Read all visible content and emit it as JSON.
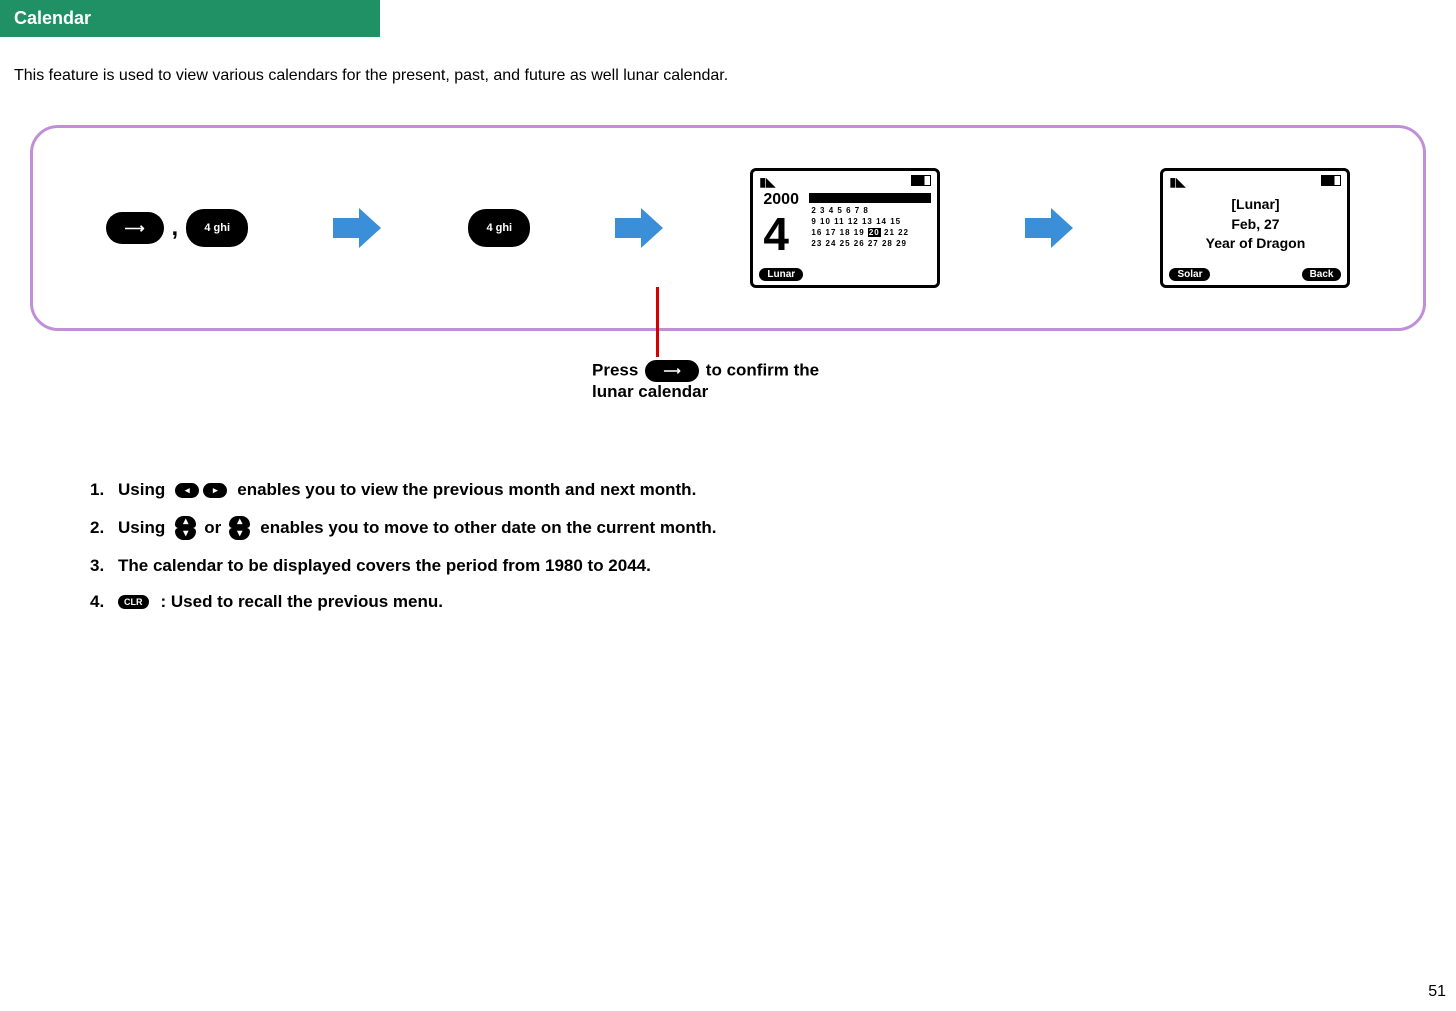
{
  "header": {
    "title": "Calendar"
  },
  "intro": "This feature is used to view various calendars for the present, past, and future as well lunar calendar.",
  "flow": {
    "step1_key": "4 ghi",
    "step2_key": "4 ghi",
    "screen_cal": {
      "year": "2000",
      "month": "4",
      "rows": [
        "2  3  4  5  6  7  8",
        "9 10 11 12 13 14 15",
        "16 17 18 19 ",
        " 21 22",
        "23 24 25 26 27 28 29"
      ],
      "highlight_day": "20",
      "soft_left": "Lunar"
    },
    "screen_lunar": {
      "title": "[Lunar]",
      "date": "Feb, 27",
      "year_text": "Year of Dragon",
      "soft_left": "Solar",
      "soft_right": "Back"
    }
  },
  "caption": {
    "pre": "Press",
    "post": "to confirm the lunar calendar"
  },
  "notes": {
    "n1_a": "Using",
    "n1_b": "enables you to view the previous month and next month.",
    "n2_a": "Using",
    "n2_or": "or",
    "n2_b": "enables you to move to other date on the current month.",
    "n3": "The calendar to be displayed covers the period from 1980 to 2044.",
    "n4": ": Used to recall the previous menu."
  },
  "page": "51"
}
